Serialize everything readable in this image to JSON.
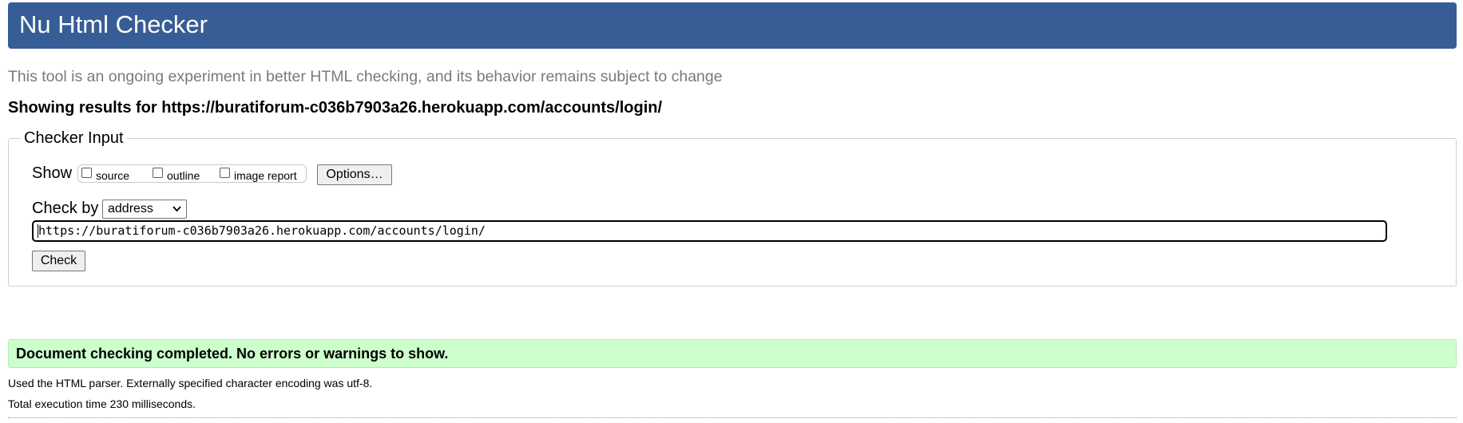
{
  "header": {
    "title": "Nu Html Checker",
    "bg_color": "#365d95"
  },
  "tagline": "This tool is an ongoing experiment in better HTML checking, and its behavior remains subject to change",
  "results_for": "Showing results for https://buratiforum-c036b7903a26.herokuapp.com/accounts/login/",
  "checker": {
    "legend": "Checker Input",
    "show_label": "Show",
    "options": [
      {
        "label": "source",
        "checked": false
      },
      {
        "label": "outline",
        "checked": false
      },
      {
        "label": "image report",
        "checked": false
      }
    ],
    "options_button": "Options…",
    "check_by_label": "Check by",
    "check_by_value": "address",
    "url_value": "https://buratiforum-c036b7903a26.herokuapp.com/accounts/login/",
    "check_button": "Check"
  },
  "result": {
    "message": "Document checking completed. No errors or warnings to show.",
    "bg_color": "#ccffcc"
  },
  "details": {
    "parser": "Used the HTML parser. Externally specified character encoding was utf-8.",
    "time": "Total execution time 230 milliseconds."
  }
}
